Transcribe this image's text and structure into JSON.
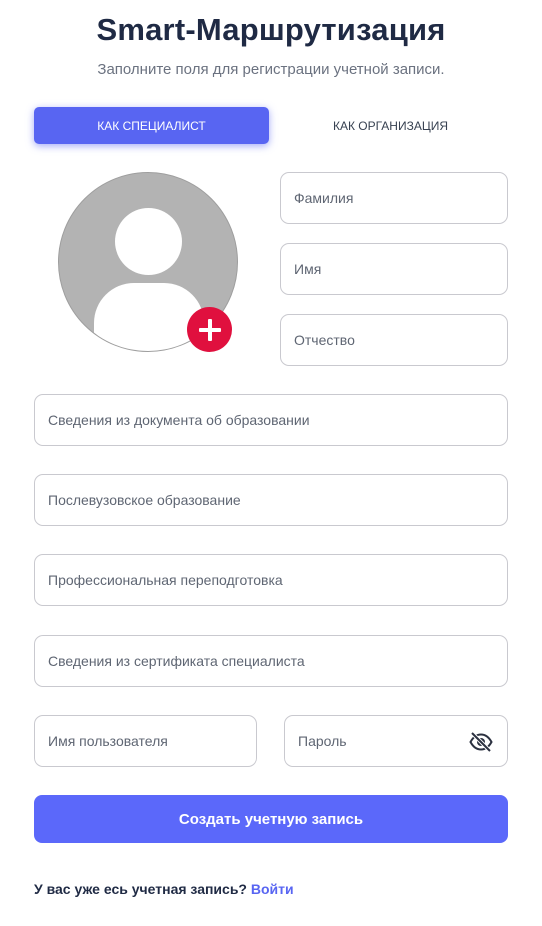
{
  "header": {
    "title": "Smart-Маршрутизация",
    "subtitle": "Заполните поля для регистрации учетной записи."
  },
  "tabs": {
    "specialist": "КАК СПЕЦИАЛИСТ",
    "organization": "КАК ОРГАНИЗАЦИЯ",
    "active": "specialist"
  },
  "avatar": {
    "placeholder_icon": "user-silhouette-icon",
    "add_icon": "plus-icon"
  },
  "fields": {
    "last_name": {
      "placeholder": "Фамилия",
      "value": ""
    },
    "first_name": {
      "placeholder": "Имя",
      "value": ""
    },
    "middle_name": {
      "placeholder": "Отчество",
      "value": ""
    },
    "education_doc": {
      "placeholder": "Сведения из документа об образовании",
      "value": ""
    },
    "postgraduate": {
      "placeholder": "Послевузовское образование",
      "value": ""
    },
    "retraining": {
      "placeholder": "Профессиональная переподготовка",
      "value": ""
    },
    "certificate": {
      "placeholder": "Сведения из сертификата специалиста",
      "value": ""
    },
    "username": {
      "placeholder": "Имя пользователя",
      "value": ""
    },
    "password": {
      "placeholder": "Пароль",
      "value": "",
      "toggle_icon": "eye-slash-icon"
    }
  },
  "submit": {
    "label": "Создать учетную запись"
  },
  "footer": {
    "text": "У вас уже есь учетная запись?",
    "link": "Войти"
  },
  "colors": {
    "accent": "#5865f2",
    "button": "#5b68fa",
    "add_button": "#e0103e",
    "title": "#1f2a44"
  }
}
